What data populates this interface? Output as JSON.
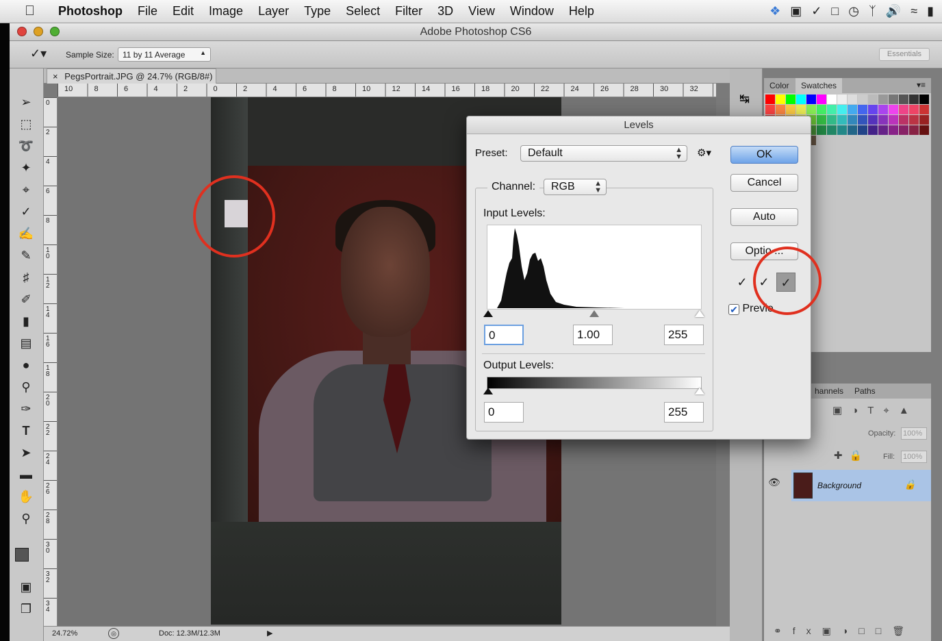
{
  "menubar": {
    "items": [
      "Photoshop",
      "File",
      "Edit",
      "Image",
      "Layer",
      "Type",
      "Select",
      "Filter",
      "3D",
      "View",
      "Window",
      "Help"
    ],
    "tray_icons": [
      "dropbox-icon",
      "menu-extra-icon",
      "script-icon",
      "display-icon",
      "time-machine-icon",
      "bluetooth-icon",
      "volume-icon",
      "wifi-icon",
      "battery-icon"
    ]
  },
  "window": {
    "title": "Adobe Photoshop CS6"
  },
  "options": {
    "sample_size_label": "Sample Size:",
    "sample_size_value": "11 by 11 Average",
    "workspace": "Essentials"
  },
  "document": {
    "tab_title": "PegsPortrait.JPG @ 24.7% (RGB/8#)",
    "ruler_h": [
      "10",
      "8",
      "6",
      "4",
      "2",
      "0",
      "2",
      "4",
      "6",
      "8",
      "10",
      "12",
      "14",
      "16",
      "18",
      "20",
      "22",
      "24",
      "26",
      "28",
      "30",
      "32"
    ],
    "ruler_v": [
      "0",
      "2",
      "4",
      "6",
      "8",
      "10",
      "12",
      "14",
      "16",
      "18",
      "20",
      "22",
      "24",
      "26",
      "28",
      "30",
      "32",
      "34"
    ],
    "zoom": "24.72%",
    "doc_info": "Doc: 12.3M/12.3M"
  },
  "panels": {
    "color_tabs": [
      "Color",
      "Swatches"
    ],
    "layer_tabs": [
      "hannels",
      "Paths"
    ],
    "opacity_label": "Opacity:",
    "opacity_value": "100%",
    "fill_label": "Fill:",
    "fill_value": "100%",
    "layer_name": "Background"
  },
  "levels": {
    "title": "Levels",
    "preset_label": "Preset:",
    "preset_value": "Default",
    "channel_label": "Channel:",
    "channel_value": "RGB",
    "input_label": "Input Levels:",
    "input_black": "0",
    "input_gamma": "1.00",
    "input_white": "255",
    "output_label": "Output Levels:",
    "output_black": "0",
    "output_white": "255",
    "buttons": {
      "ok": "OK",
      "cancel": "Cancel",
      "auto": "Auto",
      "options": "Optio   ..."
    },
    "preview_label": "Previe",
    "preview_checked": true
  },
  "colors": {
    "highlight_circle": "#e0301f",
    "ok_button": "#6ea3e8",
    "layer_selected": "#aac4e6"
  }
}
